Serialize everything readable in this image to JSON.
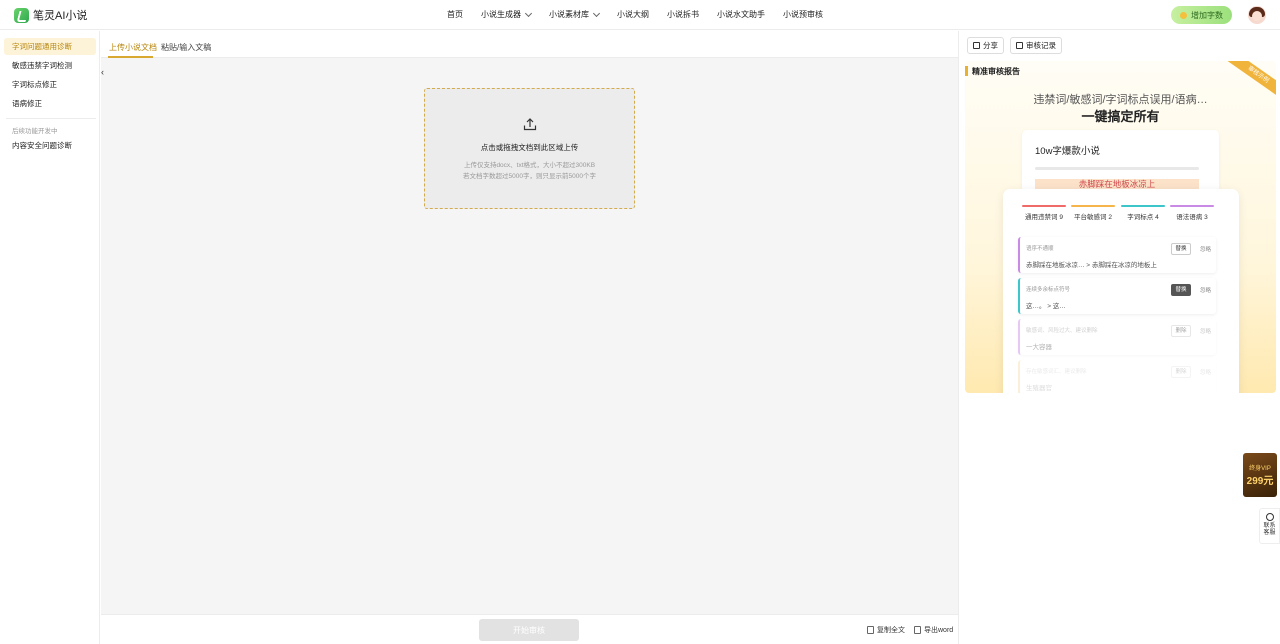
{
  "header": {
    "logo_text": "笔灵AI小说",
    "nav": [
      {
        "label": "首页",
        "dropdown": false
      },
      {
        "label": "小说生成器",
        "dropdown": true
      },
      {
        "label": "小说素材库",
        "dropdown": true
      },
      {
        "label": "小说大纲",
        "dropdown": false
      },
      {
        "label": "小说拆书",
        "dropdown": false
      },
      {
        "label": "小说水文助手",
        "dropdown": false
      },
      {
        "label": "小说预审核",
        "dropdown": false
      }
    ],
    "add_words_label": "增加字数"
  },
  "sidebar": {
    "items": [
      {
        "label": "字词问题通用诊断",
        "active": true
      },
      {
        "label": "敏感违禁字词检测",
        "active": false
      },
      {
        "label": "字词标点修正",
        "active": false
      },
      {
        "label": "语病修正",
        "active": false
      }
    ],
    "note": "后续功能开发中",
    "extra_item": "内容安全问题诊断"
  },
  "center": {
    "tabs": [
      "上传小说文档",
      "粘贴/输入文稿"
    ],
    "upload": {
      "title": "点击或拖拽文档到此区域上传",
      "hint1": "上传仅支持docx、txt格式，大小不超过300KB",
      "hint2": "若文档字数超过5000字，则只显示前5000个字"
    },
    "start_button": "开始审核",
    "copy_all": "复制全文",
    "export_word": "导出word"
  },
  "right": {
    "share": "分享",
    "review_record": "审核记录",
    "title": "精准审核报告",
    "ribbon": "审核示例",
    "promo_sub": "违禁词/敏感词/字词标点误用/语病…",
    "promo_head": "一键搞定所有",
    "back_card_title": "10w字爆款小说",
    "back_card_highlight": "赤脚踩在地板冰凉上",
    "categories": [
      {
        "label": "通用违禁词 9",
        "color": "#f06a6a"
      },
      {
        "label": "平台敏感词 2",
        "color": "#f5b54a"
      },
      {
        "label": "字词标点 4",
        "color": "#3cc6c9"
      },
      {
        "label": "语法语病 3",
        "color": "#c98ae6"
      }
    ],
    "issues": [
      {
        "label": "语序不通顺",
        "text": "赤脚踩在地板冰凉…  >  赤脚踩在冰凉的地板上",
        "primary": "替换",
        "secondary": "忽略",
        "color": "#c98ae6"
      },
      {
        "label": "连续多余标点符号",
        "text": "这…。  >  这…",
        "primary": "替换",
        "secondary": "忽略",
        "color": "#3cc6c9"
      },
      {
        "label": "敏感词、风险过大、建议删除",
        "text": "一大容器",
        "primary": "删除",
        "secondary": "忽略",
        "color": "#c98ae6"
      },
      {
        "label": "存在敏感词汇、建议删除",
        "text": "生殖器官",
        "primary": "删除",
        "secondary": "忽略",
        "color": "#f5b54a"
      }
    ]
  },
  "float": {
    "vip_label": "终身VIP",
    "vip_price": "299元",
    "contact": "联系客服"
  }
}
